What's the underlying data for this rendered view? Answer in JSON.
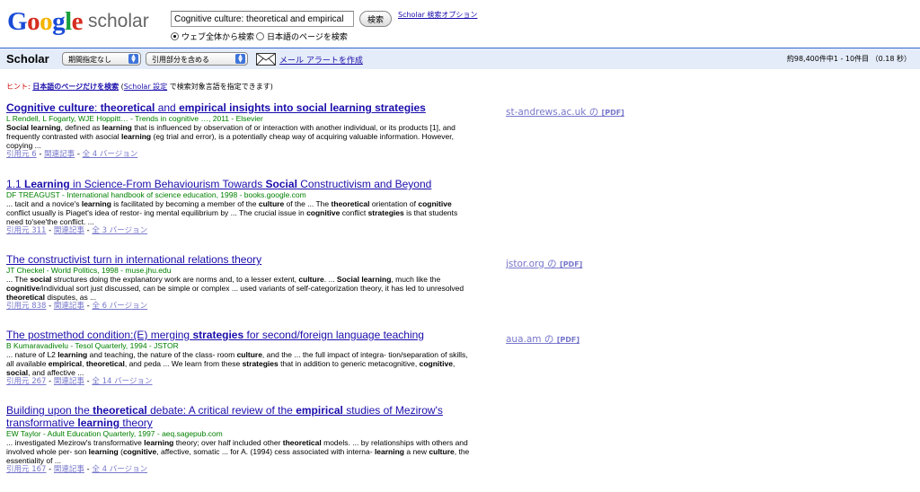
{
  "logo": {
    "brand": "Google",
    "product": "scholar"
  },
  "search": {
    "query": "Cognitive culture: theoretical and empirical",
    "button_label": "検索",
    "options_link": "Scholar 検索オプション",
    "scope_web": "ウェブ全体から検索",
    "scope_japanese": "日本語のページを検索"
  },
  "toolbar": {
    "title": "Scholar",
    "date_select": "期間指定なし",
    "citation_select": "引用部分を含める",
    "alert_link": "メール アラートを作成",
    "result_stats": "約98,400件中1 - 10件目 （0.18 秒）"
  },
  "hint": {
    "label": "ヒント:",
    "em_link": "日本語のページだけを検索",
    "open": " (",
    "settings_link": "Scholar 設定",
    "rest": " で検索対象言語を指定できます)"
  },
  "results": [
    {
      "title": [
        {
          "t": "Cognitive culture",
          "b": true
        },
        {
          "t": ": ",
          "b": false
        },
        {
          "t": "theoretical",
          "b": true
        },
        {
          "t": " and ",
          "b": false
        },
        {
          "t": "empirical insights into social learning strategies",
          "b": true
        }
      ],
      "meta": "L Rendell, L Fogarty, WJE Hoppitt… - Trends in cognitive …, 2011 - Elsevier",
      "snippet": [
        {
          "t": "Social learning",
          "b": true
        },
        {
          "t": ", defined as ",
          "b": false
        },
        {
          "t": "learning",
          "b": true
        },
        {
          "t": " that is influenced by observation of or interaction with another individual, or its products [1], and frequently contrasted with asocial ",
          "b": false
        },
        {
          "t": "learning",
          "b": true
        },
        {
          "t": " (eg trial and error), is a potentially cheap way of acquiring valuable information. However, copying ...",
          "b": false
        }
      ],
      "cited": "引用元 6",
      "related": "関連記事",
      "versions": "全 4 バージョン",
      "side": "st-andrews.ac.uk の",
      "side_pdf": "[PDF]"
    },
    {
      "title": [
        {
          "t": "1.1 ",
          "b": false
        },
        {
          "t": "Learning",
          "b": true
        },
        {
          "t": " in Science-From Behaviourism Towards ",
          "b": false
        },
        {
          "t": "Social",
          "b": true
        },
        {
          "t": " Constructivism and Beyond",
          "b": false
        }
      ],
      "meta": "DF TREAGUST - International handbook of science education, 1998 - books.google.com",
      "snippet": [
        {
          "t": "... tacit and a novice's ",
          "b": false
        },
        {
          "t": "learning",
          "b": true
        },
        {
          "t": " is facilitated by becoming a member of the ",
          "b": false
        },
        {
          "t": "culture",
          "b": true
        },
        {
          "t": " of the ... The ",
          "b": false
        },
        {
          "t": "theoretical",
          "b": true
        },
        {
          "t": " orientation of ",
          "b": false
        },
        {
          "t": "cognitive",
          "b": true
        },
        {
          "t": " conflict usually is Piaget's idea of restor- ing mental equilibrium by ... The crucial issue in ",
          "b": false
        },
        {
          "t": "cognitive",
          "b": true
        },
        {
          "t": " conflict ",
          "b": false
        },
        {
          "t": "strategies",
          "b": true
        },
        {
          "t": " is that students need to'see'the conflict. ...",
          "b": false
        }
      ],
      "cited": "引用元 311",
      "related": "関連記事",
      "versions": "全 3 バージョン",
      "side": "",
      "side_pdf": ""
    },
    {
      "title": [
        {
          "t": "The constructivist turn in international relations theory",
          "b": false
        }
      ],
      "meta": "JT Checkel - World Politics, 1998 - muse.jhu.edu",
      "snippet": [
        {
          "t": "... The ",
          "b": false
        },
        {
          "t": "social",
          "b": true
        },
        {
          "t": " structures doing the explanatory work are norms and, to a lesser extent, ",
          "b": false
        },
        {
          "t": "culture",
          "b": true
        },
        {
          "t": ". ... ",
          "b": false
        },
        {
          "t": "Social learning",
          "b": true
        },
        {
          "t": ", much like the ",
          "b": false
        },
        {
          "t": "cognitive",
          "b": true
        },
        {
          "t": "/individual sort just discussed, can be simple or complex ... used variants of self-categorization theory, it has led to unresolved ",
          "b": false
        },
        {
          "t": "theoretical",
          "b": true
        },
        {
          "t": " disputes, as ...",
          "b": false
        }
      ],
      "cited": "引用元 838",
      "related": "関連記事",
      "versions": "全 6 バージョン",
      "side": "jstor.org の",
      "side_pdf": "[PDF]"
    },
    {
      "title": [
        {
          "t": "The postmethod condition:(E) merging ",
          "b": false
        },
        {
          "t": "strategies",
          "b": true
        },
        {
          "t": " for second/foreign language teaching",
          "b": false
        }
      ],
      "meta": "B Kumaravadivelu - Tesol Quarterly, 1994 - JSTOR",
      "snippet": [
        {
          "t": "... nature of L2 ",
          "b": false
        },
        {
          "t": "learning",
          "b": true
        },
        {
          "t": " and teaching, the nature of the class- room ",
          "b": false
        },
        {
          "t": "culture",
          "b": true
        },
        {
          "t": ", and the ... the full impact of integra- tion/separation of skills, all available ",
          "b": false
        },
        {
          "t": "empirical",
          "b": true
        },
        {
          "t": ", ",
          "b": false
        },
        {
          "t": "theoretical",
          "b": true
        },
        {
          "t": ", and peda ... We learn from these ",
          "b": false
        },
        {
          "t": "strategies",
          "b": true
        },
        {
          "t": " that in addition to generic metacognitive, ",
          "b": false
        },
        {
          "t": "cognitive",
          "b": true
        },
        {
          "t": ", ",
          "b": false
        },
        {
          "t": "social",
          "b": true
        },
        {
          "t": ", and affective ...",
          "b": false
        }
      ],
      "cited": "引用元 267",
      "related": "関連記事",
      "versions": "全 14 バージョン",
      "side": "aua.am の",
      "side_pdf": "[PDF]"
    },
    {
      "title": [
        {
          "t": "Building upon the ",
          "b": false
        },
        {
          "t": "theoretical",
          "b": true
        },
        {
          "t": " debate: A critical review of the ",
          "b": false
        },
        {
          "t": "empirical",
          "b": true
        },
        {
          "t": " studies of Mezirow's transformative ",
          "b": false
        },
        {
          "t": "learning",
          "b": true
        },
        {
          "t": " theory",
          "b": false
        }
      ],
      "meta": "EW Taylor - Adult Education Quarterly, 1997 - aeq.sagepub.com",
      "snippet": [
        {
          "t": "... investigated Mezirow's transformative ",
          "b": false
        },
        {
          "t": "learning",
          "b": true
        },
        {
          "t": " theory; over half included other ",
          "b": false
        },
        {
          "t": "theoretical",
          "b": true
        },
        {
          "t": " models. ... by relationships with others and involved whole per- son ",
          "b": false
        },
        {
          "t": "learning",
          "b": true
        },
        {
          "t": " (",
          "b": false
        },
        {
          "t": "cognitive",
          "b": true
        },
        {
          "t": ", affective, somatic ... for A. (1994) cess associated with interna- ",
          "b": false
        },
        {
          "t": "learning",
          "b": true
        },
        {
          "t": " a new ",
          "b": false
        },
        {
          "t": "culture",
          "b": true
        },
        {
          "t": ", the essentiality of ...",
          "b": false
        }
      ],
      "cited": "引用元 167",
      "related": "関連記事",
      "versions": "全 4 バージョン",
      "side": "",
      "side_pdf": ""
    }
  ],
  "colors": {
    "link": "#1a0dab",
    "meta_green": "#008000",
    "visited_link": "#7777cc",
    "bar_bg": "#e5ecf9",
    "bar_border": "#3366cc",
    "hint_red": "#cc0000"
  },
  "icons": {
    "mail": "envelope-icon",
    "select_arrows": "updown-arrows-icon"
  }
}
